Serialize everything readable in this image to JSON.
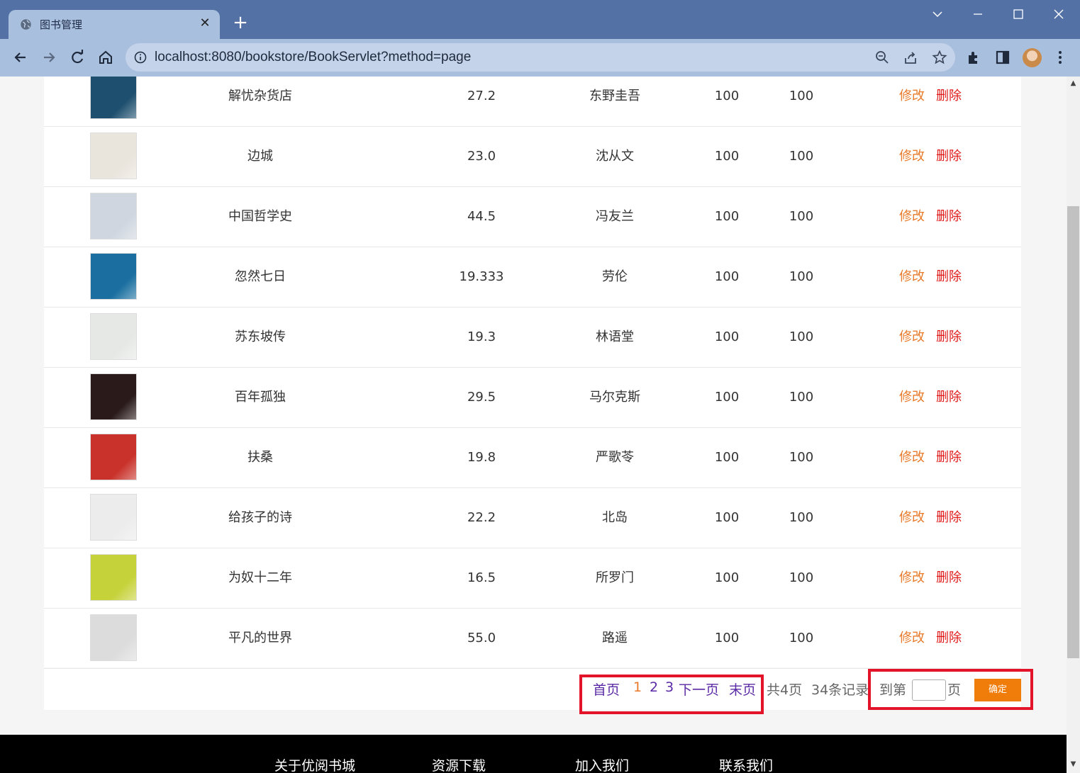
{
  "browser": {
    "tab_title": "图书管理",
    "url": "localhost:8080/bookstore/BookServlet?method=page"
  },
  "books": [
    {
      "name": "解忧杂货店",
      "price": "27.2",
      "author": "东野圭吾",
      "stock": "100",
      "sales": "100",
      "cover_color": "#1e4f6e"
    },
    {
      "name": "边城",
      "price": "23.0",
      "author": "沈从文",
      "stock": "100",
      "sales": "100",
      "cover_color": "#e9e4dc"
    },
    {
      "name": "中国哲学史",
      "price": "44.5",
      "author": "冯友兰",
      "stock": "100",
      "sales": "100",
      "cover_color": "#cfd6df"
    },
    {
      "name": "忽然七日",
      "price": "19.333",
      "author": "劳伦",
      "stock": "100",
      "sales": "100",
      "cover_color": "#1a6fa0"
    },
    {
      "name": "苏东坡传",
      "price": "19.3",
      "author": "林语堂",
      "stock": "100",
      "sales": "100",
      "cover_color": "#e6e8e6"
    },
    {
      "name": "百年孤独",
      "price": "29.5",
      "author": "马尔克斯",
      "stock": "100",
      "sales": "100",
      "cover_color": "#2a1a1a"
    },
    {
      "name": "扶桑",
      "price": "19.8",
      "author": "严歌苓",
      "stock": "100",
      "sales": "100",
      "cover_color": "#c8322a"
    },
    {
      "name": "给孩子的诗",
      "price": "22.2",
      "author": "北岛",
      "stock": "100",
      "sales": "100",
      "cover_color": "#ececec"
    },
    {
      "name": "为奴十二年",
      "price": "16.5",
      "author": "所罗门",
      "stock": "100",
      "sales": "100",
      "cover_color": "#c6d23a"
    },
    {
      "name": "平凡的世界",
      "price": "55.0",
      "author": "路遥",
      "stock": "100",
      "sales": "100",
      "cover_color": "#dcdcdc"
    }
  ],
  "actions": {
    "edit": "修改",
    "delete": "删除"
  },
  "pagination": {
    "first": "首页",
    "pages": [
      "1",
      "2",
      "3"
    ],
    "current_page": "1",
    "next": "下一页",
    "last": "末页",
    "total_pages": "共4页",
    "total_records": "34条记录",
    "goto_prefix": "到第",
    "goto_suffix": "页",
    "confirm": "确定"
  },
  "footer": {
    "links": [
      "关于优阅书城",
      "资源下载",
      "加入我们",
      "联系我们"
    ]
  },
  "colors": {
    "edit": "#e87a2a",
    "delete": "#e01919",
    "page_link": "#5a2aa6",
    "confirm_button": "#f07d09",
    "highlight_box": "#e3132a"
  }
}
